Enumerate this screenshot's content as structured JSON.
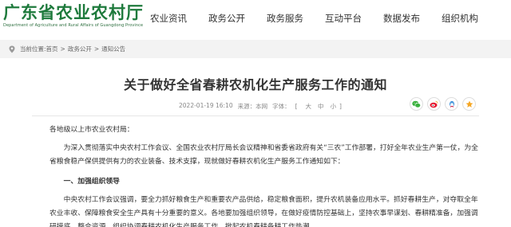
{
  "header": {
    "logo_cn": "广东省农业农村厅",
    "logo_en": "Department of Agriculture and Rural Affairs of Guangdong Province",
    "nav": [
      "农业资讯",
      "政务公开",
      "政务服务",
      "互动平台",
      "数据发布",
      "组织机构"
    ]
  },
  "breadcrumb": {
    "prefix": "当前位置:",
    "items": [
      "首页",
      "政务公开",
      "通知公告"
    ],
    "separator": ">"
  },
  "article": {
    "title": "关于做好全省春耕农机化生产服务工作的通知",
    "date": "2022-01-19 16:10",
    "source": "来源：本网",
    "font_label": "字体：",
    "font_open": "[",
    "font_sizes": [
      "大",
      "中",
      "小"
    ],
    "font_close": "]",
    "greeting": "各地级以上市农业农村局：",
    "intro": "为深入贯彻落实中央农村工作会议、全国农业农村厅局长会议精神和省委省政府有关“三农”工作部署，打好全年农业生产第一仗，为全省粮食稳产保供提供有力的农业装备、技术支撑，现就做好春耕农机化生产服务工作通知如下：",
    "section1_heading": "一、加强组织领导",
    "section1_body": "中央农村工作会议强调，要全力抓好粮食生产和重要农产品供给，稳定粮食面积，提升农机装备应用水平。抓好春耕生产，对夺取全年农业丰收、保障粮食安全生产具有十分重要的意义。各地要加强组织领导，在做好疫情防控基础上，坚持农事早谋划、春耕精准备，加强调研摸底，整合资源，组织协调春耕农机化生产服务工作，掀起农机春耕备耕工作热潮。"
  },
  "share": {
    "icons": [
      "wechat-icon",
      "weibo-icon",
      "qq-icon",
      "favorite-icon"
    ]
  },
  "colors": {
    "brand_green": "#1e7a3c",
    "breadcrumb_bg": "#f3f3f3",
    "wechat": "#3ab03e",
    "weibo": "#e6162d",
    "qq": "#3a8fd9",
    "favorite": "#f5a623"
  }
}
